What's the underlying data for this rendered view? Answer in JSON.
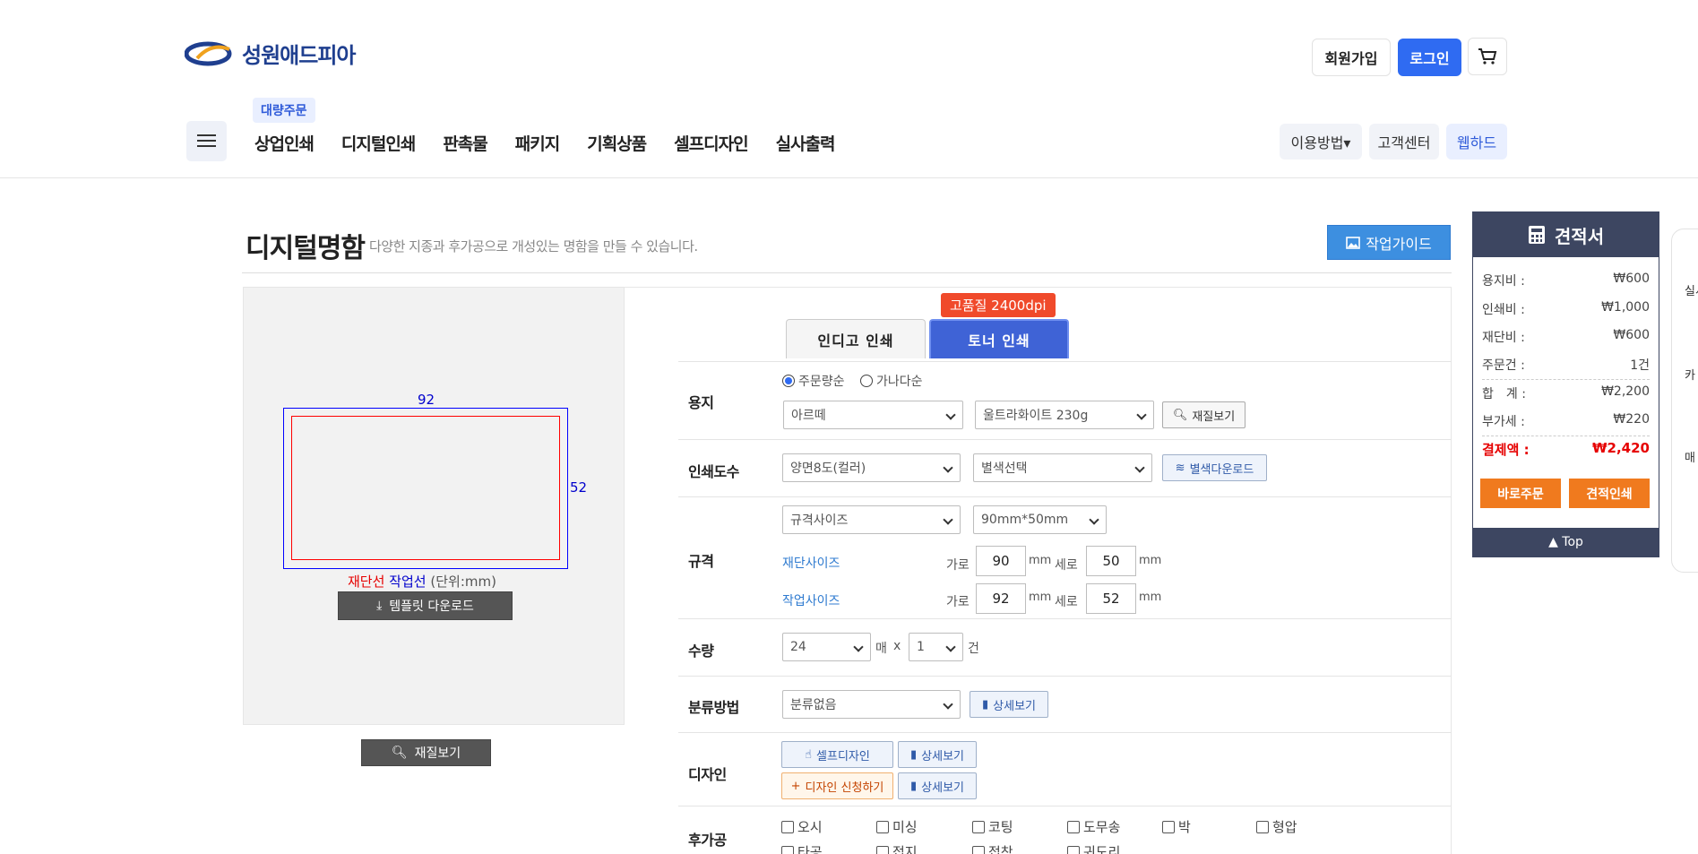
{
  "header": {
    "logo_text": "성원애드피아",
    "signup_label": "회원가입",
    "login_label": "로그인",
    "cart_icon": "cart-icon",
    "bulk_badge": "대량주문",
    "gnb": [
      "상업인쇄",
      "디지털인쇄",
      "판촉물",
      "패키지",
      "기획상품",
      "셀프디자인",
      "실사출력"
    ],
    "util": {
      "how_to": "이용방법▾",
      "support": "고객센터",
      "webhard": "웹하드"
    },
    "colors": {
      "brand": "#1f3f8f",
      "accent": "#2f6bf2"
    }
  },
  "page": {
    "title": "디지털명함",
    "subtitle": "다양한 지종과 후가공으로 개성있는 명함을 만들 수 있습니다.",
    "guide_button": "작업가이드"
  },
  "preview": {
    "width_label": "92",
    "height_label": "52",
    "cut_line": "재단선",
    "work_line": "작업선",
    "unit": "(단위:mm)",
    "template_button": "템플릿 다운로드",
    "material_button": "재질보기"
  },
  "tabs": {
    "indigo": "인디고 인쇄",
    "toner": "토너 인쇄",
    "hq_badge": "고품질 2400dpi"
  },
  "form": {
    "paper": {
      "label": "용지",
      "sort_order": "주문량순",
      "sort_alpha": "가나다순",
      "paper_type": "아르떼",
      "paper_weight": "울트라화이트 230g",
      "material_button": "재질보기"
    },
    "colors": {
      "label": "인쇄도수",
      "value": "양면8도(컬러)",
      "spot": "별색선택",
      "spot_download": "별색다운로드"
    },
    "size": {
      "label": "규격",
      "type": "규격사이즈",
      "preset": "90mm*50mm",
      "cut_label": "재단사이즈",
      "work_label": "작업사이즈",
      "w_label": "가로",
      "h_label": "세로",
      "mm": "mm",
      "cut_w": "90",
      "cut_h": "50",
      "work_w": "92",
      "work_h": "52"
    },
    "qty": {
      "label": "수량",
      "sheets": "24",
      "sheet_unit": "매",
      "times": "x",
      "count": "1",
      "count_unit": "건"
    },
    "sort": {
      "label": "분류방법",
      "value": "분류없음",
      "detail": "상세보기"
    },
    "design": {
      "label": "디자인",
      "self": "셀프디자인",
      "request": "디자인 신청하기",
      "detail": "상세보기"
    },
    "post": {
      "label": "후가공",
      "options": [
        "오시",
        "미싱",
        "코팅",
        "도무송",
        "박",
        "형압"
      ],
      "options2": [
        "타공",
        "접지",
        "접착",
        "귀도리"
      ]
    }
  },
  "estimate": {
    "title": "견적서",
    "rows": [
      {
        "k": "용지비 :",
        "v": "₩600"
      },
      {
        "k": "인쇄비 :",
        "v": "₩1,000"
      },
      {
        "k": "재단비 :",
        "v": "₩600"
      },
      {
        "k": "주문건 :",
        "v": "1건"
      },
      {
        "k": "합　계 :",
        "v": "₩2,200"
      },
      {
        "k": "부가세 :",
        "v": "₩220"
      }
    ],
    "total_label": "결제액 :",
    "total_value": "₩2,420",
    "order_button": "바로주문",
    "print_button": "견적인쇄",
    "top_button": "▲ Top"
  },
  "side_strip": [
    "실시",
    "카",
    "매"
  ]
}
